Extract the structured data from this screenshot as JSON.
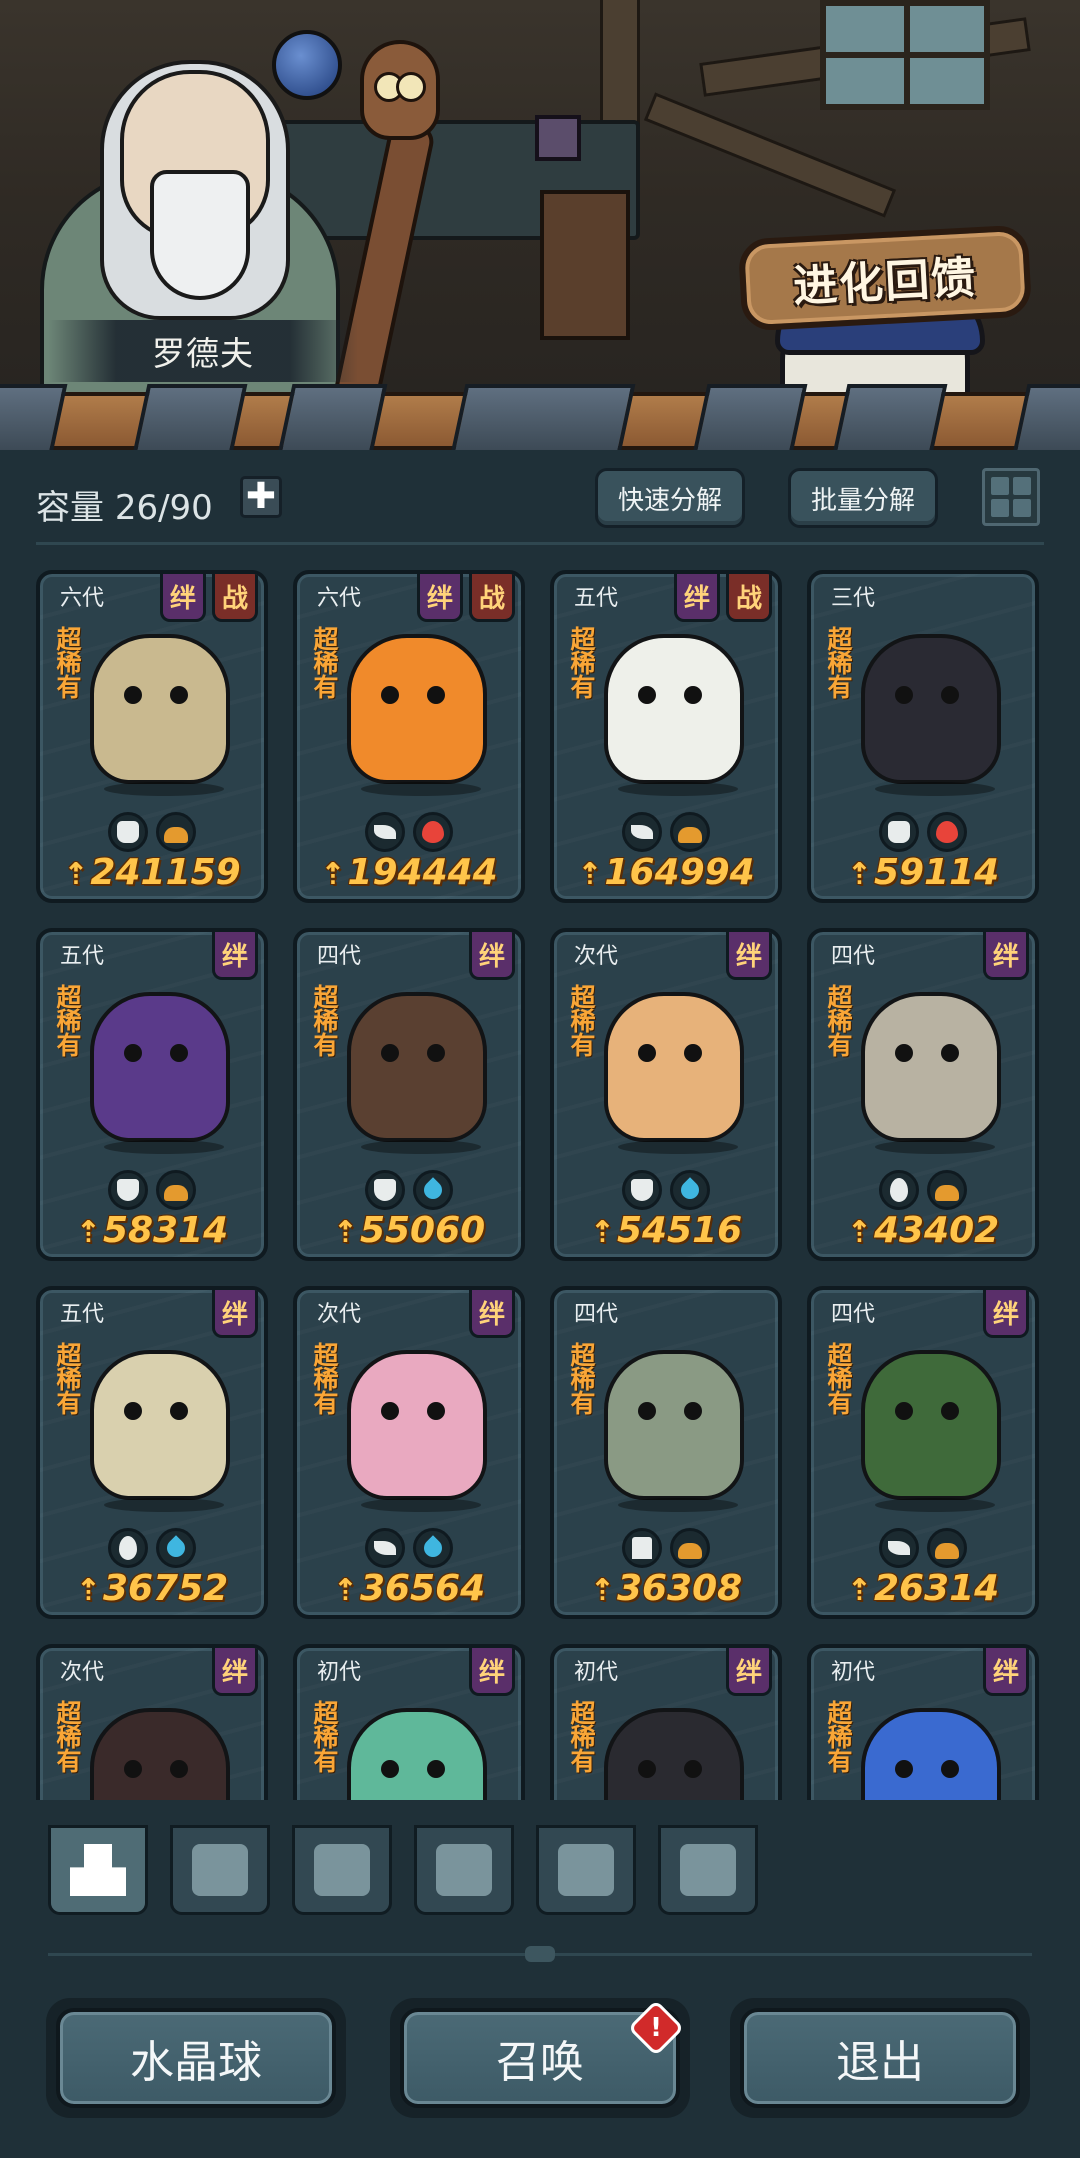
{
  "npc": {
    "name": "罗德夫"
  },
  "evolution_sign": "进化回馈",
  "toolbar": {
    "capacity_label": "容量",
    "capacity_value": "26/90",
    "add_label": "✚",
    "quick_decompose": "快速分解",
    "batch_decompose": "批量分解"
  },
  "tags": {
    "bond": "绊",
    "war": "战"
  },
  "rarity": "超稀有",
  "cards": [
    {
      "gen": "六代",
      "tags": [
        "bond",
        "war"
      ],
      "attributes": [
        "fist-icon",
        "ground-icon"
      ],
      "power": "241159",
      "color": "#c9b98f"
    },
    {
      "gen": "六代",
      "tags": [
        "bond",
        "war"
      ],
      "attributes": [
        "leaf-icon",
        "fire-icon"
      ],
      "power": "194444",
      "color": "#f08a2b"
    },
    {
      "gen": "五代",
      "tags": [
        "bond",
        "war"
      ],
      "attributes": [
        "leaf-icon",
        "ground-icon"
      ],
      "power": "164994",
      "color": "#eef0ea"
    },
    {
      "gen": "三代",
      "tags": [],
      "attributes": [
        "fist-icon",
        "fire-icon"
      ],
      "power": "59114",
      "color": "#2a2a33"
    },
    {
      "gen": "五代",
      "tags": [
        "bond"
      ],
      "attributes": [
        "shield-icon",
        "ground-icon"
      ],
      "power": "58314",
      "color": "#5a3a8a"
    },
    {
      "gen": "四代",
      "tags": [
        "bond"
      ],
      "attributes": [
        "shield-icon",
        "water-icon"
      ],
      "power": "55060",
      "color": "#5a4031"
    },
    {
      "gen": "次代",
      "tags": [
        "bond"
      ],
      "attributes": [
        "shield-icon",
        "water-icon"
      ],
      "power": "54516",
      "color": "#e7b27a"
    },
    {
      "gen": "四代",
      "tags": [
        "bond"
      ],
      "attributes": [
        "alien-icon",
        "ground-icon"
      ],
      "power": "43402",
      "color": "#b8b2a2"
    },
    {
      "gen": "五代",
      "tags": [
        "bond"
      ],
      "attributes": [
        "alien-icon",
        "water-icon"
      ],
      "power": "36752",
      "color": "#d9d0ae"
    },
    {
      "gen": "次代",
      "tags": [
        "bond"
      ],
      "attributes": [
        "leaf-icon",
        "water-icon"
      ],
      "power": "36564",
      "color": "#e9a9c0"
    },
    {
      "gen": "四代",
      "tags": [],
      "attributes": [
        "tower-icon",
        "ground-icon"
      ],
      "power": "36308",
      "color": "#8a9a84"
    },
    {
      "gen": "四代",
      "tags": [
        "bond"
      ],
      "attributes": [
        "leaf-icon",
        "ground-icon"
      ],
      "power": "26314",
      "color": "#3f6a3a"
    },
    {
      "gen": "次代",
      "tags": [
        "bond"
      ],
      "attributes": [],
      "power": "",
      "color": "#3a2a2a"
    },
    {
      "gen": "初代",
      "tags": [
        "bond"
      ],
      "attributes": [],
      "power": "",
      "color": "#5fb89a"
    },
    {
      "gen": "初代",
      "tags": [
        "bond"
      ],
      "attributes": [],
      "power": "",
      "color": "#2a2a30"
    },
    {
      "gen": "初代",
      "tags": [
        "bond"
      ],
      "attributes": [],
      "power": "",
      "color": "#3a6ad0"
    }
  ],
  "filters": [
    {
      "name": "all-filter-icon",
      "active": true
    },
    {
      "name": "fist-filter-icon",
      "active": false
    },
    {
      "name": "shield-filter-icon",
      "active": false
    },
    {
      "name": "leaf-filter-icon",
      "active": false
    },
    {
      "name": "alien-filter-icon",
      "active": false
    },
    {
      "name": "tower-filter-icon",
      "active": false
    }
  ],
  "buttons": {
    "crystal_ball": "水晶球",
    "summon": "召唤",
    "summon_alert": "!",
    "exit": "退出"
  }
}
